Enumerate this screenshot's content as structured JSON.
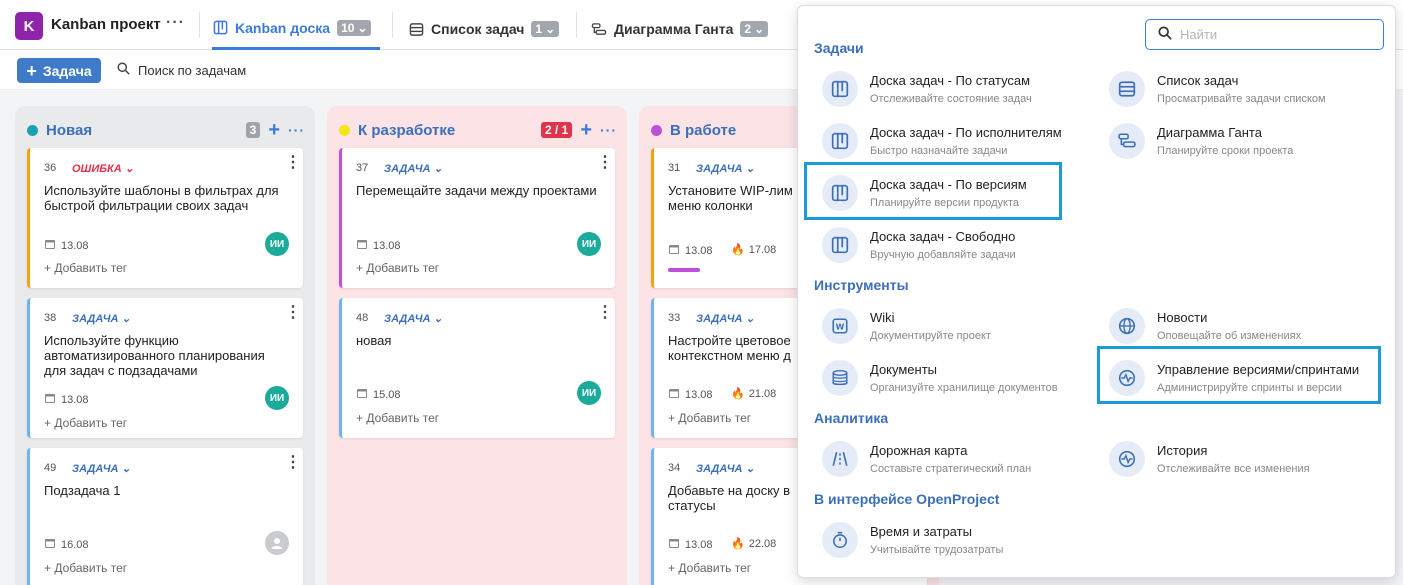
{
  "header": {
    "project_initial": "K",
    "project_name": "Kanban проект",
    "tabs": [
      {
        "label": "Kanban доска",
        "count": "10"
      },
      {
        "label": "Список задач",
        "count": "1"
      },
      {
        "label": "Диаграмма Ганта",
        "count": "2"
      }
    ]
  },
  "toolbar": {
    "add_label": "Задача",
    "search_label": "Поиск по задачам"
  },
  "columns": [
    {
      "title": "Новая",
      "count": "3",
      "dot_color": "#1aa1b0"
    },
    {
      "title": "К разработке",
      "count": "2 / 1",
      "dot_color": "#f5e31b"
    },
    {
      "title": "В работе",
      "count": "",
      "dot_color": "#c04fd8"
    }
  ],
  "cards": [
    {
      "num": "36",
      "type": "ОШИБКА",
      "title": "Используйте шаблоны в фильтрах для быстрой фильтрации своих задач",
      "date": "13.08",
      "avatar": "ИИ",
      "addtag": "+ Добавить тег"
    },
    {
      "num": "38",
      "type": "ЗАДАЧА",
      "title": "Используйте функцию автоматизированного планирования для задач с подзадачами",
      "date": "13.08",
      "avatar": "ИИ",
      "addtag": "+ Добавить тег"
    },
    {
      "num": "49",
      "type": "ЗАДАЧА",
      "title": "Подзадача 1",
      "date": "16.08",
      "avatar": "",
      "addtag": "+ Добавить тег"
    },
    {
      "num": "37",
      "type": "ЗАДАЧА",
      "title": "Перемещайте задачи между проектами",
      "date": "13.08",
      "avatar": "ИИ",
      "addtag": "+ Добавить тег"
    },
    {
      "num": "48",
      "type": "ЗАДАЧА",
      "title": "новая",
      "date": "15.08",
      "avatar": "ИИ",
      "addtag": "+ Добавить тег"
    },
    {
      "num": "31",
      "type": "ЗАДАЧА",
      "title": "Установите WIP-лим меню колонки",
      "date": "13.08",
      "due": "17.08",
      "addtag": ""
    },
    {
      "num": "33",
      "type": "ЗАДАЧА",
      "title": "Настройте цветовое контекстном меню д",
      "date": "13.08",
      "due": "21.08",
      "addtag": "+ Добавить тег"
    },
    {
      "num": "34",
      "type": "ЗАДАЧА",
      "title": "Добавьте на доску в статусы",
      "date": "13.08",
      "due": "22.08",
      "addtag": "+ Добавить тег"
    }
  ],
  "menu": {
    "search_placeholder": "Найти",
    "sections": {
      "tasks": "Задачи",
      "tools": "Инструменты",
      "analytics": "Аналитика",
      "openproject": "В интерфейсе OpenProject"
    },
    "items": [
      {
        "name": "Доска задач - По статусам",
        "desc": "Отслеживайте состояние задач"
      },
      {
        "name": "Список задач",
        "desc": "Просматривайте задачи списком"
      },
      {
        "name": "Доска задач - По исполнителям",
        "desc": "Быстро назначайте задачи"
      },
      {
        "name": "Диаграмма Ганта",
        "desc": "Планируйте сроки проекта"
      },
      {
        "name": "Доска задач - По версиям",
        "desc": "Планируйте версии продукта"
      },
      {
        "name": "Доска задач - Свободно",
        "desc": "Вручную добавляйте задачи"
      },
      {
        "name": "Wiki",
        "desc": "Документируйте проект"
      },
      {
        "name": "Новости",
        "desc": "Оповещайте об изменениях"
      },
      {
        "name": "Документы",
        "desc": "Организуйте хранилище документов"
      },
      {
        "name": "Управление версиями/спринтами",
        "desc": "Администрируйте спринты и версии"
      },
      {
        "name": "Дорожная карта",
        "desc": "Составьте стратегический план"
      },
      {
        "name": "История",
        "desc": "Отслеживайте все изменения"
      },
      {
        "name": "Время и затраты",
        "desc": "Учитывайте трудозатраты"
      }
    ]
  }
}
